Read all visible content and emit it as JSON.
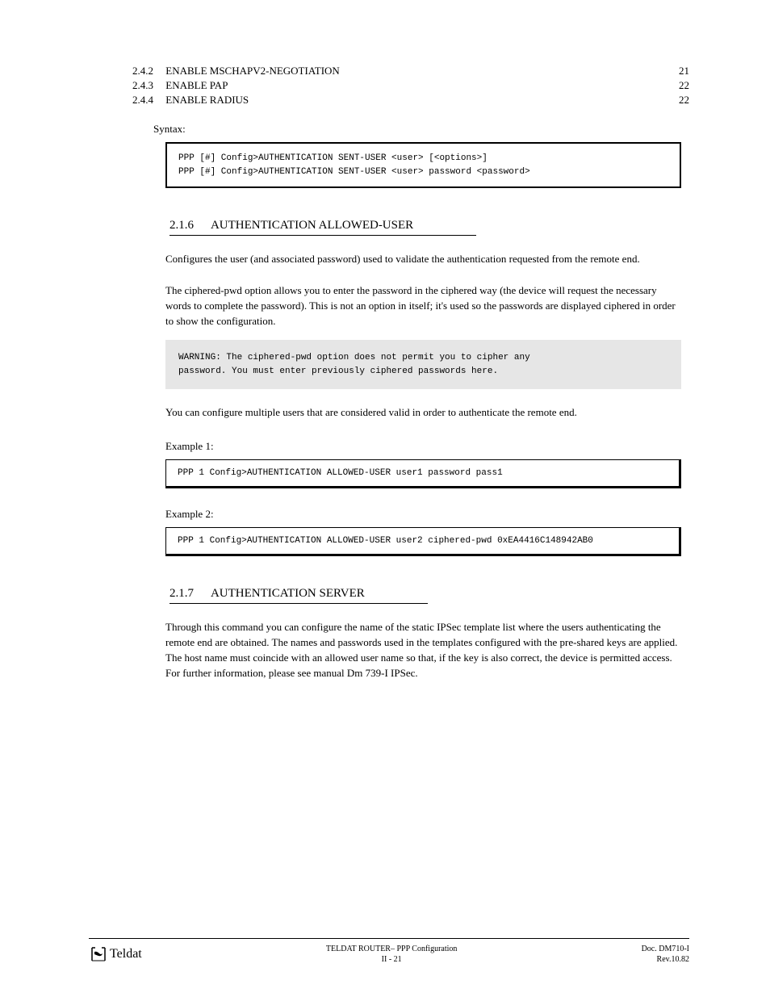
{
  "toc": [
    {
      "num": "2.4.2",
      "text": "ENABLE MSCHAPV2-NEGOTIATION",
      "page": "21"
    },
    {
      "num": "2.4.3",
      "text": "ENABLE PAP",
      "page": "22"
    },
    {
      "num": "2.4.4",
      "text": "ENABLE RADIUS",
      "page": "22"
    }
  ],
  "syntax_label": "Syntax:",
  "codebox1_line1": "PPP [#] Config>AUTHENTICATION SENT-USER <user> [<options>]",
  "codebox1_line2": "PPP [#] Config>AUTHENTICATION SENT-USER <user> password <password>",
  "section1": {
    "num": "2.1.6",
    "title": "AUTHENTICATION ALLOWED-USER",
    "para1": "Configures the user (and associated password) used to validate the authentication requested from the remote end.",
    "para2": "The ciphered-pwd option allows you to enter the password in the ciphered way (the device will request the necessary words to complete the password). This is not an option in itself; it's used so the passwords are displayed ciphered in order to show the configuration.",
    "warning_line1": "WARNING: The ciphered-pwd option does not permit you to cipher any",
    "warning_line2": "password. You must enter previously ciphered passwords here.",
    "para3": "You can configure multiple users that are considered valid in order to authenticate the remote end.",
    "example_label": "Example 1:",
    "example1": "PPP 1 Config>AUTHENTICATION ALLOWED-USER user1 password pass1",
    "example_label2": "Example 2:",
    "example2": "PPP 1 Config>AUTHENTICATION ALLOWED-USER user2 ciphered-pwd 0xEA4416C148942AB0"
  },
  "section2": {
    "num": "2.1.7",
    "title": "AUTHENTICATION SERVER",
    "para": "Through this command you can configure the name of the static IPSec template list where the users authenticating the remote end are obtained. The names and passwords used in the templates configured with the pre-shared keys are applied. The host name must coincide with an allowed user name so that, if the key is also correct, the device is permitted access. For further information, please see manual Dm 739-I IPSec."
  },
  "footer": {
    "brand": "Teldat",
    "center_line1": "TELDAT ROUTER– PPP Configuration",
    "center_line2": "II - 21",
    "right_line1": "Doc. DM710-I",
    "right_line2": "Rev.10.82"
  }
}
